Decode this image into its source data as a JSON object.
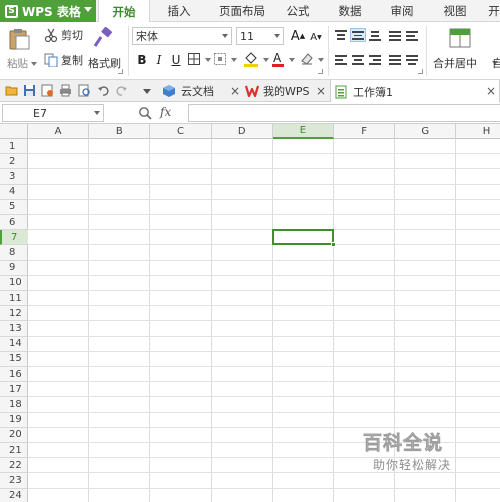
{
  "app": {
    "name": "WPS 表格",
    "logo_letter": "S"
  },
  "ribbon_tabs": [
    "开始",
    "插入",
    "页面布局",
    "公式",
    "数据",
    "审阅",
    "视图",
    "开"
  ],
  "active_ribbon_tab": "开始",
  "clipboard": {
    "paste": "粘贴",
    "cut": "剪切",
    "copy": "复制",
    "format_painter": "格式刷"
  },
  "font": {
    "name": "宋体",
    "size": "11",
    "grow": "A",
    "shrink": "A",
    "bold": "B",
    "italic": "I",
    "underline": "U",
    "font_color_letter": "A"
  },
  "alignment": {
    "merge_center": "合并居中",
    "wrap_short": "自"
  },
  "doc_tabs": [
    {
      "label": "云文档",
      "icon": "cloud-doc-icon",
      "closable": true
    },
    {
      "label": "我的WPS",
      "icon": "wps-logo-icon",
      "closable": true
    },
    {
      "label": "工作簿1",
      "icon": "spreadsheet-icon",
      "closable": true,
      "active": true
    }
  ],
  "close_glyph": "×",
  "formula_bar": {
    "name_box": "E7",
    "fx": "fx",
    "formula": ""
  },
  "sheet": {
    "columns": [
      "A",
      "B",
      "C",
      "D",
      "E",
      "F",
      "G",
      "H"
    ],
    "rows": [
      "1",
      "2",
      "3",
      "4",
      "5",
      "6",
      "7",
      "8",
      "9",
      "10",
      "11",
      "12",
      "13",
      "14",
      "15",
      "16",
      "17",
      "18",
      "19",
      "20",
      "21",
      "22",
      "23",
      "24"
    ],
    "active_column": "E",
    "active_row": "7"
  },
  "watermark": {
    "title": "百科全说",
    "subtitle": "助你轻松解决"
  },
  "colors": {
    "brand_green": "#4f9f3b",
    "active_cell_border": "#3f8f2d",
    "font_color_red": "#e02020",
    "fill_yellow": "#f2d000"
  }
}
